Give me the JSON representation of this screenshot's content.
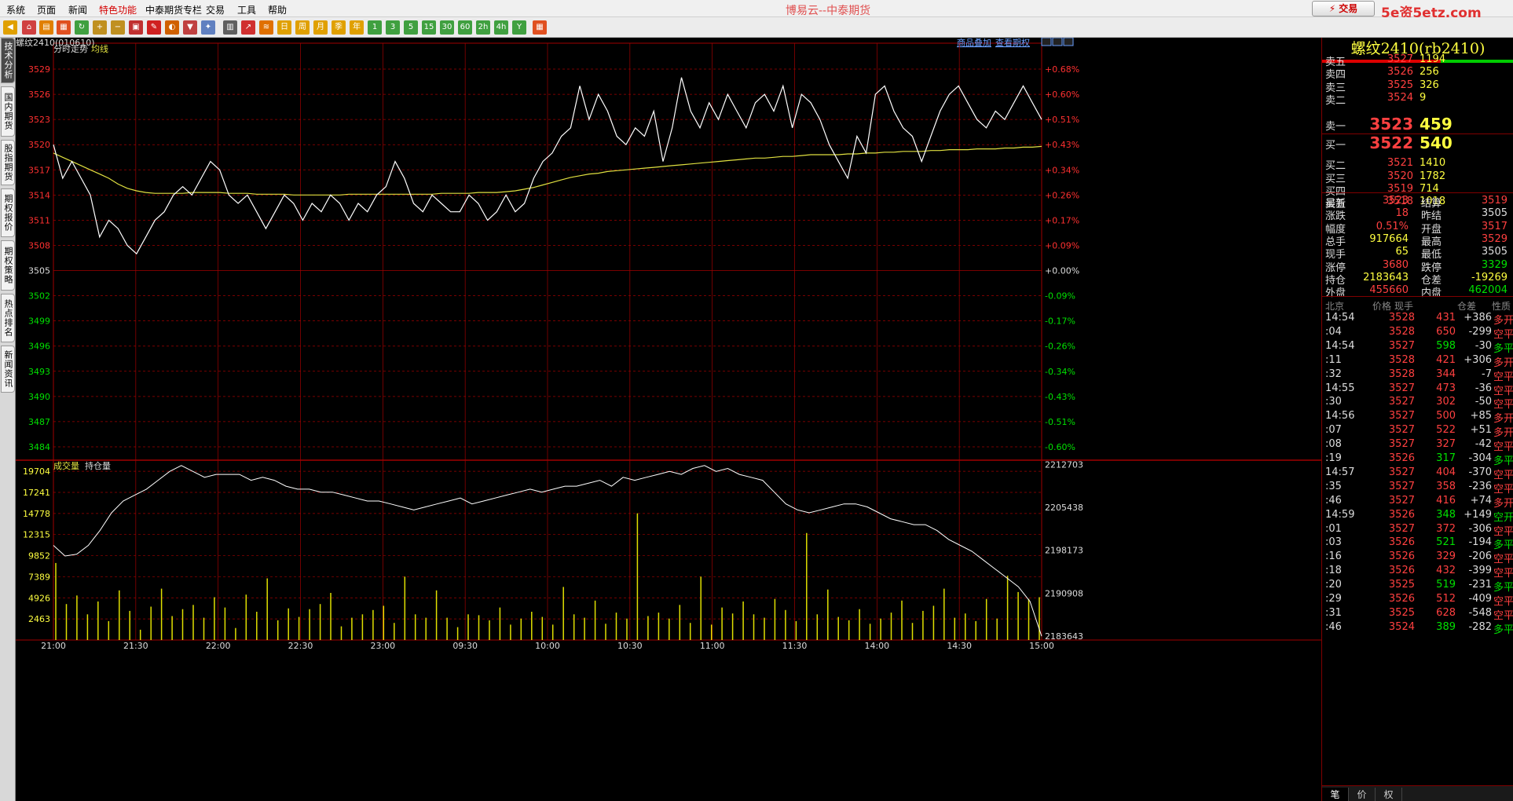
{
  "menu": {
    "items": [
      "系统",
      "页面",
      "新闻",
      "特色功能",
      "中泰期货专栏",
      "交易",
      "工具",
      "帮助"
    ],
    "active_index": 3,
    "app_title": "博易云--中泰期货",
    "trade_button": "⚡ 交易",
    "watermark": "5e资5etz.com"
  },
  "toolbar": {
    "buttons": [
      {
        "icon": "back-arrow-icon",
        "glyph": "◀",
        "color": "#e0a000"
      },
      {
        "icon": "home-icon",
        "glyph": "⌂",
        "color": "#d04040"
      },
      {
        "icon": "page-icon",
        "glyph": "▤",
        "color": "#e08000"
      },
      {
        "icon": "news-icon",
        "glyph": "▦",
        "color": "#e05020"
      },
      {
        "icon": "refresh-icon",
        "glyph": "↻",
        "color": "#40a040"
      },
      {
        "icon": "zoom-in-icon",
        "glyph": "+",
        "color": "#c09020"
      },
      {
        "icon": "zoom-out-icon",
        "glyph": "−",
        "color": "#c09020"
      },
      {
        "icon": "window-icon",
        "glyph": "▣",
        "color": "#c03030"
      },
      {
        "icon": "pen-icon",
        "glyph": "✎",
        "color": "#d02020"
      },
      {
        "icon": "palette-icon",
        "glyph": "◐",
        "color": "#d06000"
      },
      {
        "icon": "filter-icon",
        "glyph": "▼",
        "color": "#c04040"
      },
      {
        "icon": "wand-icon",
        "glyph": "✦",
        "color": "#6080c0"
      },
      {
        "icon": "table-icon",
        "glyph": "▥",
        "color": "#606060"
      },
      {
        "icon": "line-chart-icon",
        "glyph": "↗",
        "color": "#d03030"
      },
      {
        "icon": "tick-icon",
        "glyph": "≋",
        "color": "#e07000"
      },
      {
        "icon": "period-day-icon",
        "glyph": "日",
        "color": "#e0a000"
      },
      {
        "icon": "period-week-icon",
        "glyph": "周",
        "color": "#e0a000"
      },
      {
        "icon": "period-month-icon",
        "glyph": "月",
        "color": "#e0a000"
      },
      {
        "icon": "period-season-icon",
        "glyph": "季",
        "color": "#e0a000"
      },
      {
        "icon": "period-year-icon",
        "glyph": "年",
        "color": "#e0a000"
      },
      {
        "icon": "period-1m-icon",
        "glyph": "1",
        "color": "#40a040"
      },
      {
        "icon": "period-3m-icon",
        "glyph": "3",
        "color": "#40a040"
      },
      {
        "icon": "period-5m-icon",
        "glyph": "5",
        "color": "#40a040"
      },
      {
        "icon": "period-15m-icon",
        "glyph": "15",
        "color": "#40a040"
      },
      {
        "icon": "period-30m-icon",
        "glyph": "30",
        "color": "#40a040"
      },
      {
        "icon": "period-60m-icon",
        "glyph": "60",
        "color": "#40a040"
      },
      {
        "icon": "period-2h-icon",
        "glyph": "2h",
        "color": "#40a040"
      },
      {
        "icon": "period-4h-icon",
        "glyph": "4h",
        "color": "#40a040"
      },
      {
        "icon": "period-custom-icon",
        "glyph": "Y",
        "color": "#40a040"
      },
      {
        "icon": "calc-icon",
        "glyph": "▦",
        "color": "#e05020"
      }
    ]
  },
  "left_tabs": [
    "技术分析",
    "国内期货",
    "股指期货",
    "期权报价",
    "期权策略",
    "热点排名",
    "新闻资讯"
  ],
  "chart": {
    "contract_label": "螺纹2410(010610)",
    "links": [
      "商品叠加",
      "查看期权"
    ],
    "price_legend": [
      "分时走势",
      "均线"
    ],
    "volume_legend": [
      "成交量",
      "持仓量"
    ],
    "price_ticks": [
      "3529",
      "3526",
      "3523",
      "3520",
      "3517",
      "3514",
      "3511",
      "3508",
      "3505",
      "3502",
      "3499",
      "3496",
      "3493",
      "3490",
      "3487",
      "3484"
    ],
    "pct_ticks": [
      "+0.68%",
      "+0.60%",
      "+0.51%",
      "+0.43%",
      "+0.34%",
      "+0.26%",
      "+0.17%",
      "+0.09%",
      "+0.00%",
      "-0.09%",
      "-0.17%",
      "-0.26%",
      "-0.34%",
      "-0.43%",
      "-0.51%",
      "-0.60%"
    ],
    "volume_ticks": [
      "19704",
      "17241",
      "14778",
      "12315",
      "9852",
      "7389",
      "4926",
      "2463"
    ],
    "oi_ticks": [
      "2212703",
      "2205438",
      "2198173",
      "2190908",
      "2183643"
    ],
    "time_ticks": [
      "21:00",
      "21:30",
      "22:00",
      "22:30",
      "23:00",
      "09:30",
      "10:00",
      "10:30",
      "11:00",
      "11:30",
      "14:00",
      "14:30",
      "15:00"
    ],
    "colors": {
      "price_line": "#ffffff",
      "avg_line": "#e0e040",
      "volume_bar": "#e0e000",
      "oi_line": "#ffffff",
      "grid": "#a00000",
      "up": "#ff3030",
      "down": "#00e000"
    }
  },
  "chart_data": {
    "type": "line",
    "series": [
      {
        "name": "分时走势",
        "values": [
          3520,
          3516,
          3518,
          3516,
          3514,
          3509,
          3511,
          3510,
          3508,
          3507,
          3509,
          3511,
          3512,
          3514,
          3515,
          3514,
          3516,
          3518,
          3517,
          3514,
          3513,
          3514,
          3512,
          3510,
          3512,
          3514,
          3513,
          3511,
          3513,
          3512,
          3514,
          3513,
          3511,
          3513,
          3512,
          3514,
          3515,
          3518,
          3516,
          3513,
          3512,
          3514,
          3513,
          3512,
          3512,
          3514,
          3513,
          3511,
          3512,
          3514,
          3512,
          3513,
          3516,
          3518,
          3519,
          3521,
          3522,
          3527,
          3523,
          3526,
          3524,
          3521,
          3520,
          3522,
          3521,
          3524,
          3518,
          3522,
          3528,
          3524,
          3522,
          3525,
          3523,
          3526,
          3524,
          3522,
          3525,
          3526,
          3524,
          3527,
          3522,
          3526,
          3525,
          3523,
          3520,
          3518,
          3516,
          3521,
          3519,
          3526,
          3527,
          3524,
          3522,
          3521,
          3518,
          3521,
          3524,
          3526,
          3527,
          3525,
          3523,
          3522,
          3524,
          3523,
          3525,
          3527,
          3525,
          3523
        ]
      },
      {
        "name": "均线",
        "values": [
          3519,
          3518.5,
          3518,
          3517.5,
          3517,
          3516.5,
          3516,
          3515.3,
          3514.8,
          3514.5,
          3514.3,
          3514.2,
          3514.2,
          3514.2,
          3514.2,
          3514.3,
          3514.3,
          3514.3,
          3514.3,
          3514.2,
          3514.2,
          3514.2,
          3514.1,
          3514.1,
          3514.1,
          3514.1,
          3514.0,
          3514.0,
          3514.0,
          3514.0,
          3514.0,
          3514.0,
          3514.1,
          3514.1,
          3514.1,
          3514.1,
          3514.1,
          3514.1,
          3514.1,
          3514.1,
          3514.1,
          3514.1,
          3514.2,
          3514.2,
          3514.2,
          3514.2,
          3514.3,
          3514.3,
          3514.3,
          3514.4,
          3514.5,
          3514.7,
          3514.9,
          3515.2,
          3515.5,
          3515.8,
          3516.1,
          3516.3,
          3516.5,
          3516.6,
          3516.8,
          3516.9,
          3517.0,
          3517.1,
          3517.2,
          3517.3,
          3517.4,
          3517.5,
          3517.6,
          3517.7,
          3517.8,
          3517.9,
          3518.0,
          3518.1,
          3518.2,
          3518.3,
          3518.4,
          3518.4,
          3518.5,
          3518.6,
          3518.6,
          3518.7,
          3518.8,
          3518.8,
          3518.8,
          3518.8,
          3518.9,
          3518.9,
          3519.0,
          3519.0,
          3519.1,
          3519.1,
          3519.2,
          3519.2,
          3519.2,
          3519.3,
          3519.3,
          3519.4,
          3519.4,
          3519.4,
          3519.5,
          3519.5,
          3519.5,
          3519.6,
          3519.6,
          3519.7,
          3519.7,
          3519.8
        ]
      },
      {
        "name": "持仓量",
        "values": [
          2199000,
          2197200,
          2197500,
          2199000,
          2201500,
          2204500,
          2206500,
          2207500,
          2208500,
          2210000,
          2211500,
          2212500,
          2211500,
          2210500,
          2211000,
          2211000,
          2211000,
          2210000,
          2210500,
          2210000,
          2209000,
          2208500,
          2208500,
          2208000,
          2208000,
          2207500,
          2207000,
          2206500,
          2206500,
          2206000,
          2205500,
          2205000,
          2205500,
          2206000,
          2206500,
          2207000,
          2206000,
          2206500,
          2207000,
          2207500,
          2208000,
          2208500,
          2208000,
          2208500,
          2209000,
          2209000,
          2209500,
          2210000,
          2209000,
          2210500,
          2210000,
          2210500,
          2211000,
          2211500,
          2211000,
          2212000,
          2212500,
          2211500,
          2212000,
          2211000,
          2210500,
          2210000,
          2208000,
          2206000,
          2205000,
          2204500,
          2205000,
          2205500,
          2206000,
          2206000,
          2205500,
          2204500,
          2203500,
          2203000,
          2202500,
          2202500,
          2201500,
          2200000,
          2199000,
          2198000,
          2196500,
          2195000,
          2193500,
          2192000,
          2189500,
          2183643
        ]
      }
    ],
    "volume_values": [
      9000,
      4200,
      5200,
      3000,
      4500,
      2200,
      5800,
      3400,
      1200,
      3900,
      6000,
      2800,
      3600,
      4100,
      2600,
      5000,
      3800,
      1400,
      5300,
      3300,
      7200,
      2300,
      3700,
      2700,
      3600,
      4200,
      5500,
      1600,
      2600,
      3000,
      3500,
      4000,
      2000,
      7400,
      3000,
      2600,
      5800,
      2600,
      1500,
      3000,
      2900,
      2300,
      3800,
      1800,
      2500,
      3300,
      2700,
      1800,
      6200,
      3000,
      2600,
      4600,
      1900,
      3200,
      2500,
      14800,
      2800,
      3200,
      2500,
      4100,
      2000,
      7400,
      1800,
      3800,
      3100,
      4500,
      3000,
      2600,
      4800,
      3500,
      2200,
      12500,
      3000,
      5900,
      2700,
      2300,
      3600,
      1900,
      2500,
      3200,
      4600,
      2000,
      3400,
      4000,
      6000,
      2600,
      3100,
      2200,
      4800,
      2500,
      7500,
      5600,
      4800,
      5000
    ],
    "title": "螺纹2410(010610)",
    "xlabel": "",
    "ylabel": "",
    "ylim": [
      3482.5,
      3530.5
    ],
    "volume_ylim": [
      0,
      21000
    ],
    "oi_ylim": [
      2183000,
      2213400
    ],
    "grid": true
  },
  "quote": {
    "title": "螺纹2410(rb2410)",
    "buy_ratio": 0.62,
    "asks": [
      {
        "label": "卖五",
        "price": "3527",
        "vol": "1194"
      },
      {
        "label": "卖四",
        "price": "3526",
        "vol": "256"
      },
      {
        "label": "卖三",
        "price": "3525",
        "vol": "326"
      },
      {
        "label": "卖二",
        "price": "3524",
        "vol": "9"
      },
      {
        "label": "卖一",
        "price": "3523",
        "vol": "459"
      }
    ],
    "bids": [
      {
        "label": "买一",
        "price": "3522",
        "vol": "540"
      },
      {
        "label": "买二",
        "price": "3521",
        "vol": "1410"
      },
      {
        "label": "买三",
        "price": "3520",
        "vol": "1782"
      },
      {
        "label": "买四",
        "price": "3519",
        "vol": "714"
      },
      {
        "label": "买五",
        "price": "3518",
        "vol": "1018"
      }
    ],
    "stats": [
      {
        "l1": "最新",
        "v1": "3523",
        "c1": "red",
        "l2": "结算",
        "v2": "3519",
        "c2": "red"
      },
      {
        "l1": "涨跌",
        "v1": "18",
        "c1": "red",
        "l2": "昨结",
        "v2": "3505",
        "c2": "white"
      },
      {
        "l1": "幅度",
        "v1": "0.51%",
        "c1": "red",
        "l2": "开盘",
        "v2": "3517",
        "c2": "red"
      },
      {
        "l1": "总手",
        "v1": "917664",
        "c1": "yellow",
        "l2": "最高",
        "v2": "3529",
        "c2": "red"
      },
      {
        "l1": "现手",
        "v1": "65",
        "c1": "yellow",
        "l2": "最低",
        "v2": "3505",
        "c2": "white"
      },
      {
        "l1": "涨停",
        "v1": "3680",
        "c1": "red",
        "l2": "跌停",
        "v2": "3329",
        "c2": "green"
      },
      {
        "l1": "持仓",
        "v1": "2183643",
        "c1": "yellow",
        "l2": "仓差",
        "v2": "-19269",
        "c2": "yellow"
      },
      {
        "l1": "外盘",
        "v1": "455660",
        "c1": "red",
        "l2": "内盘",
        "v2": "462004",
        "c2": "green"
      }
    ],
    "tick_header": [
      "北京",
      "价格",
      "现手",
      "仓差",
      "性质"
    ],
    "ticks": [
      {
        "time": "14:54",
        "price": "3528",
        "vol": "431",
        "oi": "+386",
        "nature": "多开",
        "pc": "red",
        "vc": "red",
        "oc": "white",
        "nc": "red"
      },
      {
        "time": ":04",
        "price": "3528",
        "vol": "650",
        "oi": "-299",
        "nature": "空平",
        "pc": "red",
        "vc": "red",
        "oc": "white",
        "nc": "red"
      },
      {
        "time": "14:54",
        "price": "3527",
        "vol": "598",
        "oi": "-30",
        "nature": "多平",
        "pc": "red",
        "vc": "green",
        "oc": "white",
        "nc": "green"
      },
      {
        "time": ":11",
        "price": "3528",
        "vol": "421",
        "oi": "+306",
        "nature": "多开",
        "pc": "red",
        "vc": "red",
        "oc": "white",
        "nc": "red"
      },
      {
        "time": ":32",
        "price": "3528",
        "vol": "344",
        "oi": "-7",
        "nature": "空平",
        "pc": "red",
        "vc": "red",
        "oc": "white",
        "nc": "red"
      },
      {
        "time": "14:55",
        "price": "3527",
        "vol": "473",
        "oi": "-36",
        "nature": "空平",
        "pc": "red",
        "vc": "red",
        "oc": "white",
        "nc": "red"
      },
      {
        "time": ":30",
        "price": "3527",
        "vol": "302",
        "oi": "-50",
        "nature": "空平",
        "pc": "red",
        "vc": "red",
        "oc": "white",
        "nc": "red"
      },
      {
        "time": "14:56",
        "price": "3527",
        "vol": "500",
        "oi": "+85",
        "nature": "多开",
        "pc": "red",
        "vc": "red",
        "oc": "white",
        "nc": "red"
      },
      {
        "time": ":07",
        "price": "3527",
        "vol": "522",
        "oi": "+51",
        "nature": "多开",
        "pc": "red",
        "vc": "red",
        "oc": "white",
        "nc": "red"
      },
      {
        "time": ":08",
        "price": "3527",
        "vol": "327",
        "oi": "-42",
        "nature": "空平",
        "pc": "red",
        "vc": "red",
        "oc": "white",
        "nc": "red"
      },
      {
        "time": ":19",
        "price": "3526",
        "vol": "317",
        "oi": "-304",
        "nature": "多平",
        "pc": "red",
        "vc": "green",
        "oc": "white",
        "nc": "green"
      },
      {
        "time": "14:57",
        "price": "3527",
        "vol": "404",
        "oi": "-370",
        "nature": "空平",
        "pc": "red",
        "vc": "red",
        "oc": "white",
        "nc": "red"
      },
      {
        "time": ":35",
        "price": "3527",
        "vol": "358",
        "oi": "-236",
        "nature": "空平",
        "pc": "red",
        "vc": "red",
        "oc": "white",
        "nc": "red"
      },
      {
        "time": ":46",
        "price": "3527",
        "vol": "416",
        "oi": "+74",
        "nature": "多开",
        "pc": "red",
        "vc": "red",
        "oc": "white",
        "nc": "red"
      },
      {
        "time": "14:59",
        "price": "3526",
        "vol": "348",
        "oi": "+149",
        "nature": "空开",
        "pc": "red",
        "vc": "green",
        "oc": "white",
        "nc": "green"
      },
      {
        "time": ":01",
        "price": "3527",
        "vol": "372",
        "oi": "-306",
        "nature": "空平",
        "pc": "red",
        "vc": "red",
        "oc": "white",
        "nc": "red"
      },
      {
        "time": ":03",
        "price": "3526",
        "vol": "521",
        "oi": "-194",
        "nature": "多平",
        "pc": "red",
        "vc": "green",
        "oc": "white",
        "nc": "green"
      },
      {
        "time": ":16",
        "price": "3526",
        "vol": "329",
        "oi": "-206",
        "nature": "空平",
        "pc": "red",
        "vc": "red",
        "oc": "white",
        "nc": "red"
      },
      {
        "time": ":18",
        "price": "3526",
        "vol": "432",
        "oi": "-399",
        "nature": "空平",
        "pc": "red",
        "vc": "red",
        "oc": "white",
        "nc": "red"
      },
      {
        "time": ":20",
        "price": "3525",
        "vol": "519",
        "oi": "-231",
        "nature": "多平",
        "pc": "red",
        "vc": "green",
        "oc": "white",
        "nc": "green"
      },
      {
        "time": ":29",
        "price": "3526",
        "vol": "512",
        "oi": "-409",
        "nature": "空平",
        "pc": "red",
        "vc": "red",
        "oc": "white",
        "nc": "red"
      },
      {
        "time": ":31",
        "price": "3525",
        "vol": "628",
        "oi": "-548",
        "nature": "空平",
        "pc": "red",
        "vc": "red",
        "oc": "white",
        "nc": "red"
      },
      {
        "time": ":46",
        "price": "3524",
        "vol": "389",
        "oi": "-282",
        "nature": "多平",
        "pc": "red",
        "vc": "green",
        "oc": "white",
        "nc": "green"
      }
    ],
    "bottom_tabs": [
      "笔",
      "价",
      "权"
    ]
  }
}
